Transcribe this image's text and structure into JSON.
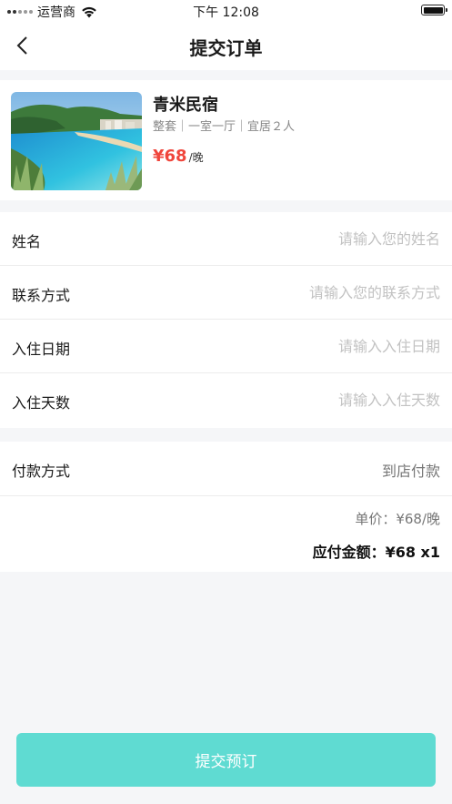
{
  "status_bar": {
    "carrier": "运营商",
    "time": "下午 12:08"
  },
  "nav": {
    "title": "提交订单",
    "back_icon": "chevron-left-icon"
  },
  "property": {
    "name": "青米民宿",
    "desc": "整套｜一室一厅｜宜居２人",
    "price": "¥68",
    "price_unit": "/晚"
  },
  "form": {
    "rows": [
      {
        "label": "姓名",
        "placeholder": "请输入您的姓名"
      },
      {
        "label": "联系方式",
        "placeholder": "请输入您的联系方式"
      },
      {
        "label": "入住日期",
        "placeholder": "请输入入住日期"
      },
      {
        "label": "入住天数",
        "placeholder": "请输入入住天数"
      }
    ]
  },
  "payment": {
    "label": "付款方式",
    "value": "到店付款",
    "unit_price": "单价：¥68/晚",
    "total": "应付金额：¥68 x1"
  },
  "submit_label": "提交预订",
  "colors": {
    "accent": "#5fdbd2",
    "price": "#f0463c",
    "background": "#f5f6f8"
  }
}
